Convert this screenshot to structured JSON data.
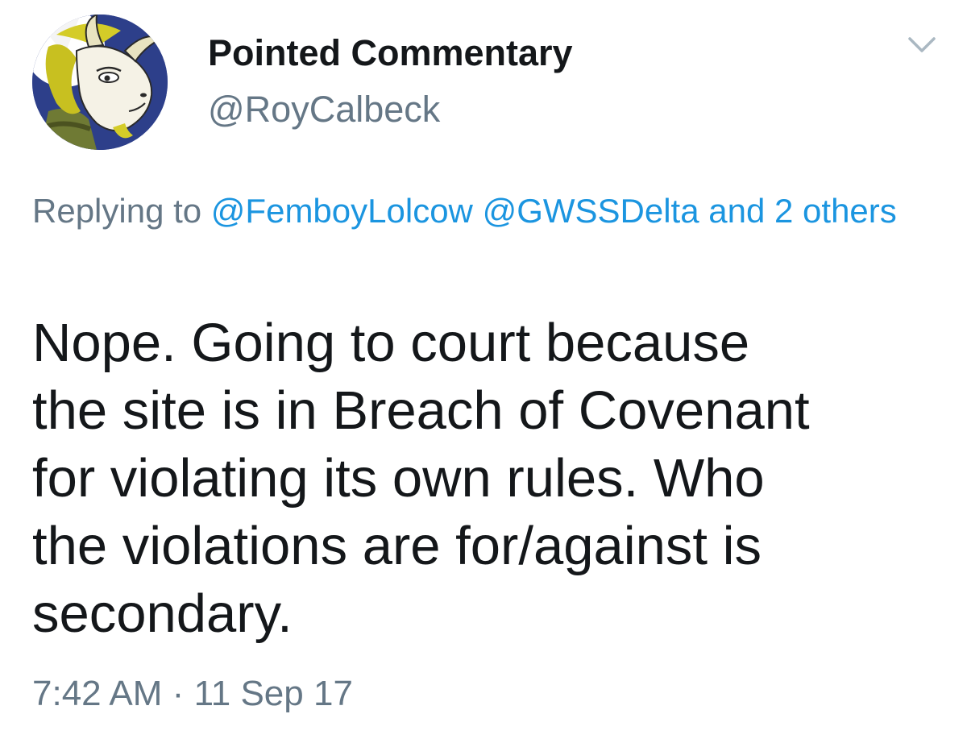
{
  "author": {
    "display_name": "Pointed Commentary",
    "handle": "@RoyCalbeck",
    "avatar_icon": "cartoon-goat-avatar"
  },
  "menu": {
    "icon": "chevron-down-icon"
  },
  "reply": {
    "prefix": "Replying to",
    "mention_1": "@FemboyLolcow",
    "mention_2": "@GWSSDelta",
    "others": "and 2 others"
  },
  "tweet": {
    "text": "Nope. Going to court because\nthe site is in Breach of Covenant\nfor violating its own rules. Who\nthe violations are for/against is\nsecondary.",
    "time": "7:42 AM",
    "separator": "·",
    "date": "11 Sep 17"
  },
  "colors": {
    "text": "#14171a",
    "secondary": "#657786",
    "link": "#1b95e0"
  }
}
